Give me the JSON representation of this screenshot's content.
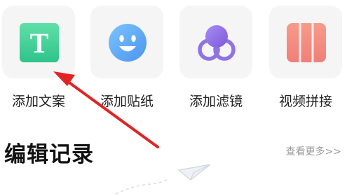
{
  "tools": {
    "text": {
      "label": "添加文案",
      "icon_letter": "T",
      "icon": "text-icon"
    },
    "sticker": {
      "label": "添加贴纸",
      "icon": "smiley-icon"
    },
    "filter": {
      "label": "添加滤镜",
      "icon": "filter-icon"
    },
    "collage": {
      "label": "视频拼接",
      "icon": "collage-icon"
    }
  },
  "history": {
    "title": "编辑记录",
    "see_more": "查看更多>>"
  },
  "colors": {
    "text_icon": "#3fcf95",
    "sticker_icon": "#5aa9f0",
    "filter_icon": "#8c6fe0",
    "collage_icon": "#f28a7e",
    "annotation_arrow": "#e02424"
  }
}
